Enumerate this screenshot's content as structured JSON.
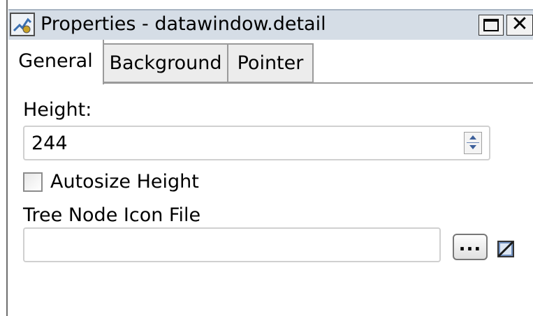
{
  "window": {
    "title": "Properties - datawindow.detail",
    "maximize_glyph": "",
    "close_glyph": "✕"
  },
  "tabs": [
    {
      "label": "General",
      "active": true
    },
    {
      "label": "Background",
      "active": false
    },
    {
      "label": "Pointer",
      "active": false
    }
  ],
  "general": {
    "height_label": "Height:",
    "height_value": "244",
    "autosize_label": "Autosize Height",
    "autosize_checked": false,
    "icon_file_label": "Tree Node Icon File",
    "icon_file_value": "",
    "browse_label": "..."
  },
  "icons": {
    "title": "properties-icon",
    "spinner": "spinner-icon",
    "clear": "clear-field-icon"
  },
  "colors": {
    "titlebar_bg": "#d5dde6",
    "inactive_tab_bg": "#ececec",
    "spinner_arrow": "#3c5f9a"
  }
}
